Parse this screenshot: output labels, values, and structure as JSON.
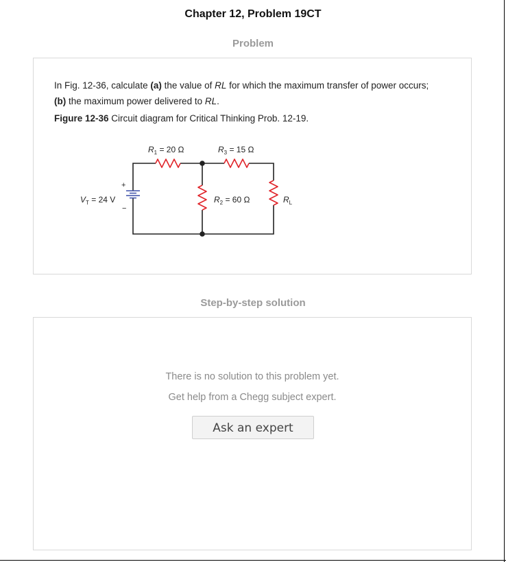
{
  "page": {
    "title": "Chapter 12, Problem 19CT"
  },
  "problem": {
    "heading": "Problem",
    "text_part1": "In Fig. 12-36, calculate ",
    "text_a_label": "(a)",
    "text_part2": " the value of ",
    "text_rl": "RL",
    "text_part3": " for which the maximum transfer of power occurs;",
    "text_b_label": "(b)",
    "text_part4": " the maximum power delivered to ",
    "text_rl2": "RL",
    "text_part5": ".",
    "figure_label": "Figure 12-36",
    "figure_caption": " Circuit diagram for Critical Thinking Prob. 12-19."
  },
  "circuit": {
    "r1_label": "R",
    "r1_sub": "1",
    "r1_value": " = 20 Ω",
    "r3_label": "R",
    "r3_sub": "3",
    "r3_value": " = 15 Ω",
    "r2_label": "R",
    "r2_sub": "2",
    "r2_value": " = 60 Ω",
    "rl_label": "R",
    "rl_sub": "L",
    "vt_label": "V",
    "vt_sub": "T",
    "vt_value": " = 24 V",
    "plus_sign": "+",
    "minus_sign": "−",
    "wire_color": "#222222",
    "resistor_color": "#e0242a",
    "battery_color": "#3a4fa8"
  },
  "solution": {
    "heading": "Step-by-step solution",
    "no_solution_line1": "There is no solution to this problem yet.",
    "no_solution_line2": "Get help from a Chegg subject expert.",
    "ask_button": "Ask an expert"
  }
}
